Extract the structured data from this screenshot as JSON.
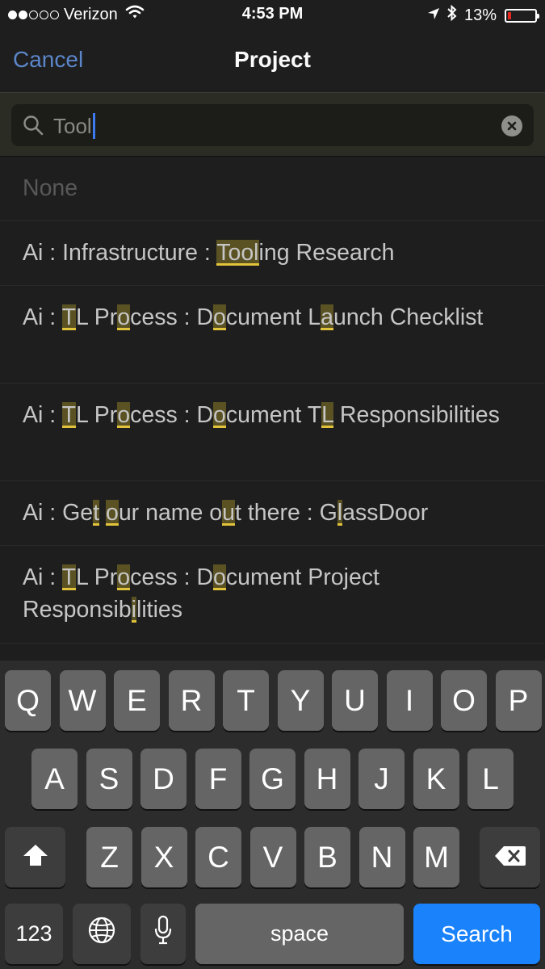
{
  "status_bar": {
    "carrier": "Verizon",
    "time": "4:53 PM",
    "battery": "13%",
    "battery_level": 0.13,
    "signal_bars_filled": 2,
    "signal_bars_total": 5,
    "icons": [
      "signal-dots-icon",
      "wifi-icon",
      "location-arrow-icon",
      "bluetooth-icon",
      "battery-icon"
    ]
  },
  "nav": {
    "cancel_label": "Cancel",
    "title": "Project"
  },
  "search": {
    "value": "Tool",
    "icon": "search-icon",
    "clear_icon": "clear-icon"
  },
  "results": [
    {
      "text": "None",
      "highlights": [],
      "none": true
    },
    {
      "text": "Ai : Infrastructure : Tooling Research",
      "highlights": [
        [
          22,
          26
        ]
      ]
    },
    {
      "text": "Ai : TL Process : Document Launch Checklist",
      "highlights": [
        [
          5,
          6
        ],
        [
          10,
          11
        ],
        [
          19,
          20
        ],
        [
          28,
          29
        ]
      ],
      "lines": 2
    },
    {
      "text": "Ai : TL Process : Document TL Responsibilities",
      "highlights": [
        [
          5,
          6
        ],
        [
          10,
          11
        ],
        [
          19,
          20
        ],
        [
          28,
          29
        ]
      ],
      "lines": 2
    },
    {
      "text": "Ai : Get our name out there : GlassDoor",
      "highlights": [
        [
          7,
          8
        ],
        [
          9,
          10
        ],
        [
          19,
          20
        ],
        [
          31,
          32
        ]
      ]
    },
    {
      "text": "Ai : TL Process : Document Project Responsibilities",
      "highlights": [
        [
          5,
          6
        ],
        [
          10,
          11
        ],
        [
          19,
          20
        ],
        [
          44,
          45
        ]
      ],
      "lines": 2
    }
  ],
  "keyboard": {
    "row1": [
      "Q",
      "W",
      "E",
      "R",
      "T",
      "Y",
      "U",
      "I",
      "O",
      "P"
    ],
    "row2": [
      "A",
      "S",
      "D",
      "F",
      "G",
      "H",
      "J",
      "K",
      "L"
    ],
    "row3": [
      "Z",
      "X",
      "C",
      "V",
      "B",
      "N",
      "M"
    ],
    "numbers_label": "123",
    "space_label": "space",
    "search_label": "Search",
    "shift_icon": "shift-icon",
    "delete_icon": "delete-icon",
    "globe_icon": "globe-icon",
    "mic_icon": "microphone-icon",
    "accent_color": "#1a82fb"
  }
}
